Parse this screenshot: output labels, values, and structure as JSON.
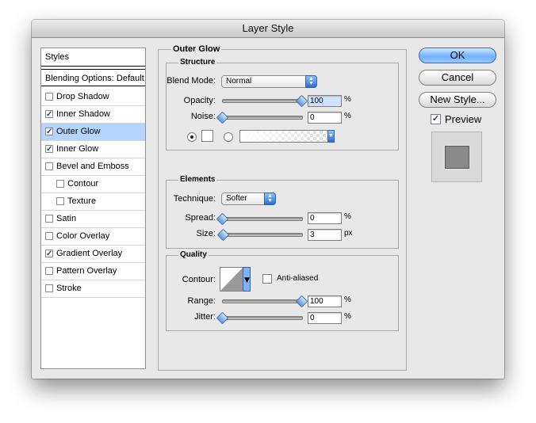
{
  "window": {
    "title": "Layer Style"
  },
  "styles_panel": {
    "header": "Styles",
    "blending": "Blending Options: Default",
    "items": [
      {
        "label": "Drop Shadow",
        "checked": false,
        "selected": false,
        "indent": false
      },
      {
        "label": "Inner Shadow",
        "checked": true,
        "selected": false,
        "indent": false
      },
      {
        "label": "Outer Glow",
        "checked": true,
        "selected": true,
        "indent": false
      },
      {
        "label": "Inner Glow",
        "checked": true,
        "selected": false,
        "indent": false
      },
      {
        "label": "Bevel and Emboss",
        "checked": false,
        "selected": false,
        "indent": false
      },
      {
        "label": "Contour",
        "checked": false,
        "selected": false,
        "indent": true
      },
      {
        "label": "Texture",
        "checked": false,
        "selected": false,
        "indent": true
      },
      {
        "label": "Satin",
        "checked": false,
        "selected": false,
        "indent": false
      },
      {
        "label": "Color Overlay",
        "checked": false,
        "selected": false,
        "indent": false
      },
      {
        "label": "Gradient Overlay",
        "checked": true,
        "selected": false,
        "indent": false
      },
      {
        "label": "Pattern Overlay",
        "checked": false,
        "selected": false,
        "indent": false
      },
      {
        "label": "Stroke",
        "checked": false,
        "selected": false,
        "indent": false
      }
    ]
  },
  "outer_glow": {
    "title": "Outer Glow",
    "structure": {
      "title": "Structure",
      "blend_mode_label": "Blend Mode:",
      "blend_mode_value": "Normal",
      "opacity_label": "Opacity:",
      "opacity_value": "100",
      "opacity_unit": "%",
      "opacity_level": 1.0,
      "noise_label": "Noise:",
      "noise_value": "0",
      "noise_unit": "%",
      "noise_level": 0.0,
      "color_mode": "solid"
    },
    "elements": {
      "title": "Elements",
      "technique_label": "Technique:",
      "technique_value": "Softer",
      "spread_label": "Spread:",
      "spread_value": "0",
      "spread_unit": "%",
      "spread_level": 0.0,
      "size_label": "Size:",
      "size_value": "3",
      "size_unit": "px",
      "size_level": 0.012
    },
    "quality": {
      "title": "Quality",
      "contour_label": "Contour:",
      "anti_aliased_label": "Anti-aliased",
      "anti_aliased_checked": false,
      "range_label": "Range:",
      "range_value": "100",
      "range_unit": "%",
      "range_level": 1.0,
      "jitter_label": "Jitter:",
      "jitter_value": "0",
      "jitter_unit": "%",
      "jitter_level": 0.0
    }
  },
  "buttons": {
    "ok": "OK",
    "cancel": "Cancel",
    "new_style": "New Style...",
    "preview_label": "Preview",
    "preview_checked": true
  },
  "colors": {
    "accent": "#5f97dc",
    "selection": "#b5d5ff",
    "preview_swatch": "#8a8a8a"
  }
}
